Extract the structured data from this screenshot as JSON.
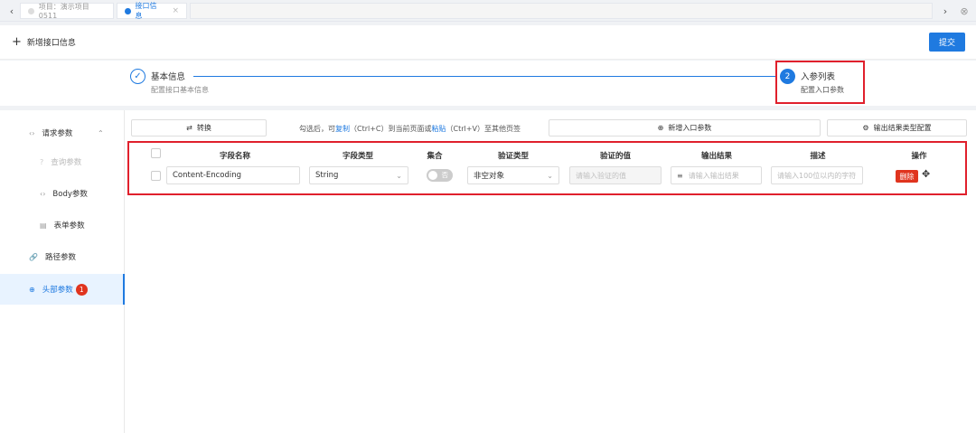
{
  "tabs": [
    {
      "label": "项目：演示项目0511",
      "active": false
    },
    {
      "label": "接口信息",
      "active": true,
      "close": "×"
    }
  ],
  "nav": {
    "prev": "‹",
    "next": "›",
    "close_all": "⊗"
  },
  "header": {
    "add_label": "新增接口信息",
    "submit_label": "提交"
  },
  "steps": [
    {
      "index": "✓",
      "title": "基本信息",
      "desc": "配置接口基本信息"
    },
    {
      "index": "2",
      "title": "入参列表",
      "desc": "配置入口参数"
    }
  ],
  "sidebar": {
    "items": [
      {
        "label": "请求参数",
        "icon": "‹›"
      },
      {
        "label": "查询参数",
        "icon": "?"
      },
      {
        "label": "Body参数",
        "icon": "‹›"
      },
      {
        "label": "表单参数",
        "icon": "▤"
      },
      {
        "label": "路径参数",
        "icon": "🔗"
      },
      {
        "label": "头部参数",
        "icon": "⊕",
        "badge": "1"
      }
    ]
  },
  "toolbar": {
    "convert_label": "转换",
    "hint_pre": "勾选后，可",
    "hint_copy": "复制",
    "hint_mid1": "（Ctrl+C）到当前页面或",
    "hint_paste": "粘贴",
    "hint_mid2": "（Ctrl+V）至其他页签",
    "add_param_label": "新增入口参数",
    "output_config_label": "输出结果类型配置"
  },
  "table": {
    "headers": [
      "字段名称",
      "字段类型",
      "集合",
      "验证类型",
      "验证的值",
      "输出结果",
      "描述",
      "操作"
    ],
    "row": {
      "field_name": "Content-Encoding",
      "field_type": "String",
      "collection_toggle": "否",
      "validation_type": "非空对象",
      "validation_value_placeholder": "请输入验证的值",
      "output_placeholder": "请输入输出结果",
      "desc_placeholder": "请输入100位以内的字符",
      "delete_label": "删除"
    }
  }
}
